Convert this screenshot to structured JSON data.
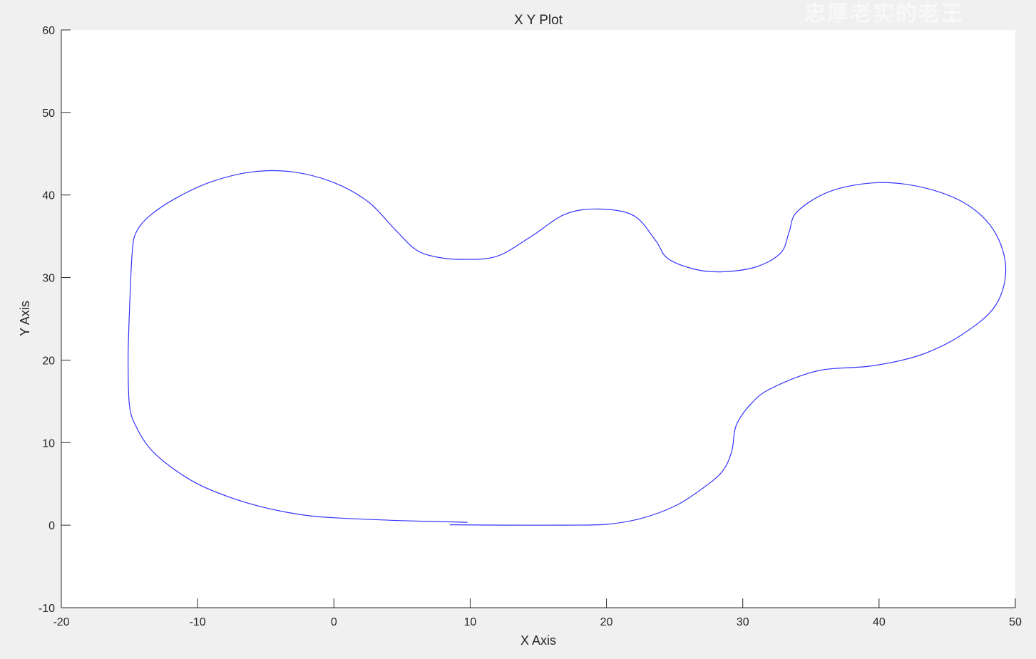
{
  "chart_data": {
    "type": "line",
    "title": "X Y Plot",
    "xlabel": "X Axis",
    "ylabel": "Y Axis",
    "xlim": [
      -20,
      50
    ],
    "ylim": [
      -10,
      60
    ],
    "xticks": [
      -20,
      -10,
      0,
      10,
      20,
      30,
      40,
      50
    ],
    "yticks": [
      -10,
      0,
      10,
      20,
      30,
      40,
      50,
      60
    ],
    "grid": false,
    "line_color": "#3333ff",
    "series": [
      {
        "values": [
          [
            9.8,
            0.35
          ],
          [
            5.0,
            0.55
          ],
          [
            0.0,
            0.9
          ],
          [
            -2.5,
            1.3
          ],
          [
            -5.0,
            2.1
          ],
          [
            -7.5,
            3.3
          ],
          [
            -10.0,
            5.0
          ],
          [
            -12.0,
            7.1
          ],
          [
            -13.5,
            9.3
          ],
          [
            -14.5,
            11.9
          ],
          [
            -15.0,
            14.5
          ],
          [
            -15.1,
            20.0
          ],
          [
            -15.0,
            26.0
          ],
          [
            -14.8,
            33.0
          ],
          [
            -14.5,
            35.5
          ],
          [
            -13.5,
            37.5
          ],
          [
            -11.5,
            39.7
          ],
          [
            -9.0,
            41.6
          ],
          [
            -6.0,
            42.8
          ],
          [
            -3.0,
            42.8
          ],
          [
            0.0,
            41.5
          ],
          [
            2.5,
            39.2
          ],
          [
            4.5,
            35.8
          ],
          [
            6.0,
            33.4
          ],
          [
            7.5,
            32.5
          ],
          [
            9.5,
            32.2
          ],
          [
            12.0,
            32.6
          ],
          [
            14.5,
            35.0
          ],
          [
            17.0,
            37.7
          ],
          [
            19.5,
            38.3
          ],
          [
            22.0,
            37.5
          ],
          [
            23.6,
            34.5
          ],
          [
            24.5,
            32.3
          ],
          [
            26.5,
            31.0
          ],
          [
            28.5,
            30.7
          ],
          [
            31.0,
            31.3
          ],
          [
            32.8,
            33.0
          ],
          [
            33.4,
            35.5
          ],
          [
            34.0,
            38.0
          ],
          [
            36.5,
            40.5
          ],
          [
            40.0,
            41.5
          ],
          [
            43.5,
            40.8
          ],
          [
            46.5,
            38.8
          ],
          [
            48.5,
            35.5
          ],
          [
            49.3,
            31.0
          ],
          [
            48.5,
            26.5
          ],
          [
            46.0,
            23.0
          ],
          [
            43.0,
            20.6
          ],
          [
            39.5,
            19.3
          ],
          [
            35.5,
            18.7
          ],
          [
            32.0,
            16.5
          ],
          [
            30.5,
            14.5
          ],
          [
            29.5,
            12.0
          ],
          [
            29.2,
            9.0
          ],
          [
            28.5,
            6.5
          ],
          [
            27.0,
            4.4
          ],
          [
            25.0,
            2.3
          ],
          [
            22.5,
            0.8
          ],
          [
            20.0,
            0.1
          ],
          [
            17.0,
            0.0
          ],
          [
            12.5,
            0.0
          ],
          [
            8.5,
            0.05
          ]
        ]
      }
    ]
  },
  "watermark": "忠厚老实的老王"
}
